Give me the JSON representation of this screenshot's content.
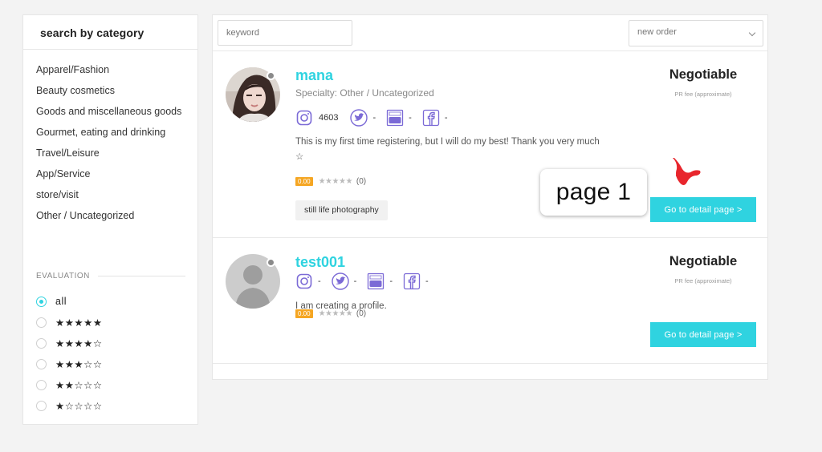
{
  "sidebar": {
    "title": "search by category",
    "categories": [
      "Apparel/Fashion",
      "Beauty cosmetics",
      "Goods and miscellaneous goods",
      "Gourmet, eating and drinking",
      "Travel/Leisure",
      "App/Service",
      "store/visit",
      "Other / Uncategorized"
    ],
    "evaluation_label": "EVALUATION",
    "ratings": [
      {
        "label": "all",
        "selected": true
      },
      {
        "label": "★★★★★",
        "selected": false
      },
      {
        "label": "★★★★☆",
        "selected": false
      },
      {
        "label": "★★★☆☆",
        "selected": false
      },
      {
        "label": "★★☆☆☆",
        "selected": false
      },
      {
        "label": "★☆☆☆☆",
        "selected": false
      }
    ]
  },
  "toolbar": {
    "keyword_placeholder": "keyword",
    "order_value": "new order"
  },
  "cards": [
    {
      "name": "mana",
      "specialty": "Specialty: Other / Uncategorized",
      "instagram": "4603",
      "twitter": "-",
      "youtube": "-",
      "facebook": "-",
      "bio": "This is my first time registering, but I will do my best! Thank you very much ☆",
      "score": "0.00",
      "stars": "★★★★★",
      "review_count": "(0)",
      "tag": "still life photography",
      "price": "Negotiable",
      "fee": "PR fee (approximate)",
      "button": "Go to detail page >"
    },
    {
      "name": "test001",
      "instagram": "-",
      "twitter": "-",
      "youtube": "-",
      "facebook": "-",
      "bio": "I am creating a profile.",
      "score": "0.00",
      "stars": "★★★★★",
      "review_count": "(0)",
      "price": "Negotiable",
      "fee": "PR fee (approximate)",
      "button": "Go to detail page >"
    }
  ],
  "annotation": {
    "label": "page 1"
  },
  "colors": {
    "accent": "#2fd3e0",
    "score_badge": "#f5a623",
    "annotation_mark": "#e8262d",
    "social_icon": "#7b6ad6"
  },
  "icons": {
    "instagram": "instagram-icon",
    "twitter": "twitter-icon",
    "youtube": "youtube-icon",
    "facebook": "facebook-icon"
  }
}
